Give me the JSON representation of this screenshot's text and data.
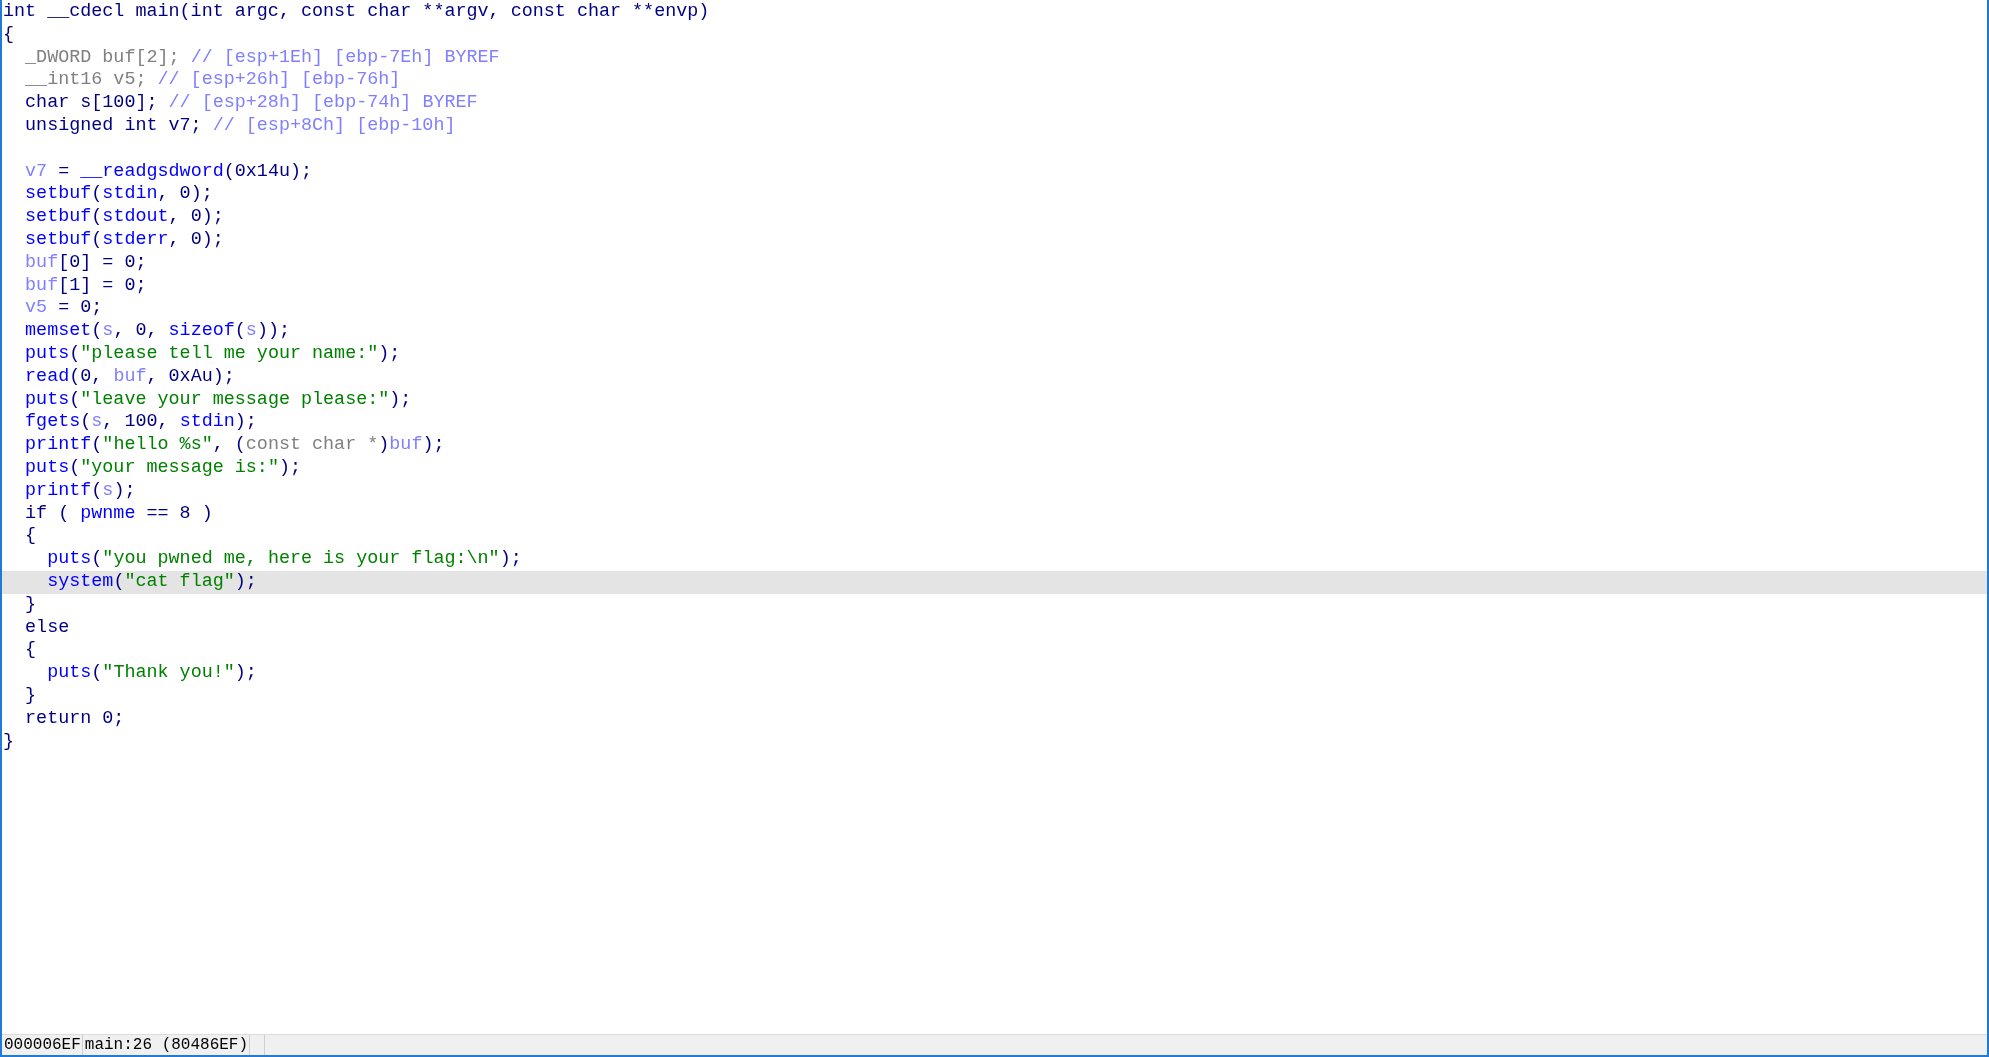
{
  "code_lines": [
    {
      "kind": "code",
      "selected": false,
      "tokens": [
        {
          "kind": "kw",
          "text": "int __cdecl main(int argc, const char **argv, const char **envp)"
        }
      ]
    },
    {
      "kind": "code",
      "selected": false,
      "tokens": [
        {
          "kind": "kw",
          "text": "{"
        }
      ]
    },
    {
      "kind": "code",
      "selected": false,
      "tokens": [
        {
          "kind": "type",
          "text": "  _DWORD buf[2]; "
        },
        {
          "kind": "comment",
          "text": "// [esp+1Eh] [ebp-7Eh] BYREF"
        }
      ]
    },
    {
      "kind": "code",
      "selected": false,
      "tokens": [
        {
          "kind": "type",
          "text": "  __int16 v5; "
        },
        {
          "kind": "comment",
          "text": "// [esp+26h] [ebp-76h]"
        }
      ]
    },
    {
      "kind": "code",
      "selected": false,
      "tokens": [
        {
          "kind": "kw",
          "text": "  char s[100]; "
        },
        {
          "kind": "comment",
          "text": "// [esp+28h] [ebp-74h] BYREF"
        }
      ]
    },
    {
      "kind": "code",
      "selected": false,
      "tokens": [
        {
          "kind": "kw",
          "text": "  unsigned int v7; "
        },
        {
          "kind": "comment",
          "text": "// [esp+8Ch] [ebp-10h]"
        }
      ]
    },
    {
      "kind": "blank",
      "selected": false
    },
    {
      "kind": "code",
      "selected": false,
      "tokens": [
        {
          "kind": "var",
          "text": "  v7"
        },
        {
          "kind": "kw",
          "text": " = "
        },
        {
          "kind": "fn",
          "text": "__readgsdword"
        },
        {
          "kind": "kw",
          "text": "(0x14u);"
        }
      ]
    },
    {
      "kind": "code",
      "selected": false,
      "tokens": [
        {
          "kind": "fn",
          "text": "  setbuf"
        },
        {
          "kind": "kw",
          "text": "("
        },
        {
          "kind": "fn",
          "text": "stdin"
        },
        {
          "kind": "kw",
          "text": ", 0);"
        }
      ]
    },
    {
      "kind": "code",
      "selected": false,
      "tokens": [
        {
          "kind": "fn",
          "text": "  setbuf"
        },
        {
          "kind": "kw",
          "text": "("
        },
        {
          "kind": "fn",
          "text": "stdout"
        },
        {
          "kind": "kw",
          "text": ", 0);"
        }
      ]
    },
    {
      "kind": "code",
      "selected": false,
      "tokens": [
        {
          "kind": "fn",
          "text": "  setbuf"
        },
        {
          "kind": "kw",
          "text": "("
        },
        {
          "kind": "fn",
          "text": "stderr"
        },
        {
          "kind": "kw",
          "text": ", 0);"
        }
      ]
    },
    {
      "kind": "code",
      "selected": false,
      "tokens": [
        {
          "kind": "var",
          "text": "  buf"
        },
        {
          "kind": "kw",
          "text": "[0] = 0;"
        }
      ]
    },
    {
      "kind": "code",
      "selected": false,
      "tokens": [
        {
          "kind": "var",
          "text": "  buf"
        },
        {
          "kind": "kw",
          "text": "[1] = 0;"
        }
      ]
    },
    {
      "kind": "code",
      "selected": false,
      "tokens": [
        {
          "kind": "var",
          "text": "  v5"
        },
        {
          "kind": "kw",
          "text": " = 0;"
        }
      ]
    },
    {
      "kind": "code",
      "selected": false,
      "tokens": [
        {
          "kind": "fn",
          "text": "  memset"
        },
        {
          "kind": "kw",
          "text": "("
        },
        {
          "kind": "var",
          "text": "s"
        },
        {
          "kind": "kw",
          "text": ", 0, "
        },
        {
          "kind": "fn",
          "text": "sizeof"
        },
        {
          "kind": "kw",
          "text": "("
        },
        {
          "kind": "var",
          "text": "s"
        },
        {
          "kind": "kw",
          "text": "));"
        }
      ]
    },
    {
      "kind": "code",
      "selected": false,
      "tokens": [
        {
          "kind": "fn",
          "text": "  puts"
        },
        {
          "kind": "kw",
          "text": "("
        },
        {
          "kind": "str",
          "text": "\"please tell me your name:\""
        },
        {
          "kind": "kw",
          "text": ");"
        }
      ]
    },
    {
      "kind": "code",
      "selected": false,
      "tokens": [
        {
          "kind": "fn",
          "text": "  read"
        },
        {
          "kind": "kw",
          "text": "(0, "
        },
        {
          "kind": "var",
          "text": "buf"
        },
        {
          "kind": "kw",
          "text": ", 0xAu);"
        }
      ]
    },
    {
      "kind": "code",
      "selected": false,
      "tokens": [
        {
          "kind": "fn",
          "text": "  puts"
        },
        {
          "kind": "kw",
          "text": "("
        },
        {
          "kind": "str",
          "text": "\"leave your message please:\""
        },
        {
          "kind": "kw",
          "text": ");"
        }
      ]
    },
    {
      "kind": "code",
      "selected": false,
      "tokens": [
        {
          "kind": "fn",
          "text": "  fgets"
        },
        {
          "kind": "kw",
          "text": "("
        },
        {
          "kind": "var",
          "text": "s"
        },
        {
          "kind": "kw",
          "text": ", 100, "
        },
        {
          "kind": "fn",
          "text": "stdin"
        },
        {
          "kind": "kw",
          "text": ");"
        }
      ]
    },
    {
      "kind": "code",
      "selected": false,
      "tokens": [
        {
          "kind": "fn",
          "text": "  printf"
        },
        {
          "kind": "kw",
          "text": "("
        },
        {
          "kind": "str",
          "text": "\"hello %s\""
        },
        {
          "kind": "kw",
          "text": ", ("
        },
        {
          "kind": "type",
          "text": "const char *"
        },
        {
          "kind": "kw",
          "text": ")"
        },
        {
          "kind": "var",
          "text": "buf"
        },
        {
          "kind": "kw",
          "text": ");"
        }
      ]
    },
    {
      "kind": "code",
      "selected": false,
      "tokens": [
        {
          "kind": "fn",
          "text": "  puts"
        },
        {
          "kind": "kw",
          "text": "("
        },
        {
          "kind": "str",
          "text": "\"your message is:\""
        },
        {
          "kind": "kw",
          "text": ");"
        }
      ]
    },
    {
      "kind": "code",
      "selected": false,
      "tokens": [
        {
          "kind": "fn",
          "text": "  printf"
        },
        {
          "kind": "kw",
          "text": "("
        },
        {
          "kind": "var",
          "text": "s"
        },
        {
          "kind": "kw",
          "text": ");"
        }
      ]
    },
    {
      "kind": "code",
      "selected": false,
      "tokens": [
        {
          "kind": "kw",
          "text": "  if ( "
        },
        {
          "kind": "fn",
          "text": "pwnme"
        },
        {
          "kind": "kw",
          "text": " == 8 )"
        }
      ]
    },
    {
      "kind": "code",
      "selected": false,
      "tokens": [
        {
          "kind": "kw",
          "text": "  {"
        }
      ]
    },
    {
      "kind": "code",
      "selected": false,
      "tokens": [
        {
          "kind": "fn",
          "text": "    puts"
        },
        {
          "kind": "kw",
          "text": "("
        },
        {
          "kind": "str",
          "text": "\"you pwned me, here is your flag:\\n\""
        },
        {
          "kind": "kw",
          "text": ");"
        }
      ]
    },
    {
      "kind": "code",
      "selected": true,
      "tokens": [
        {
          "kind": "fn",
          "text": "    system"
        },
        {
          "kind": "kw",
          "text": "("
        },
        {
          "kind": "str",
          "text": "\"cat flag\""
        },
        {
          "kind": "kw",
          "text": ");"
        }
      ]
    },
    {
      "kind": "code",
      "selected": false,
      "tokens": [
        {
          "kind": "kw",
          "text": "  }"
        }
      ]
    },
    {
      "kind": "code",
      "selected": false,
      "tokens": [
        {
          "kind": "kw",
          "text": "  else"
        }
      ]
    },
    {
      "kind": "code",
      "selected": false,
      "tokens": [
        {
          "kind": "kw",
          "text": "  {"
        }
      ]
    },
    {
      "kind": "code",
      "selected": false,
      "tokens": [
        {
          "kind": "fn",
          "text": "    puts"
        },
        {
          "kind": "kw",
          "text": "("
        },
        {
          "kind": "str",
          "text": "\"Thank you!\""
        },
        {
          "kind": "kw",
          "text": ");"
        }
      ]
    },
    {
      "kind": "code",
      "selected": false,
      "tokens": [
        {
          "kind": "kw",
          "text": "  }"
        }
      ]
    },
    {
      "kind": "code",
      "selected": false,
      "tokens": [
        {
          "kind": "kw",
          "text": "  return 0;"
        }
      ]
    },
    {
      "kind": "code",
      "selected": false,
      "tokens": [
        {
          "kind": "kw",
          "text": "}"
        }
      ]
    }
  ],
  "status_bar": [
    "000006EF",
    "main:26 (80486EF)"
  ]
}
